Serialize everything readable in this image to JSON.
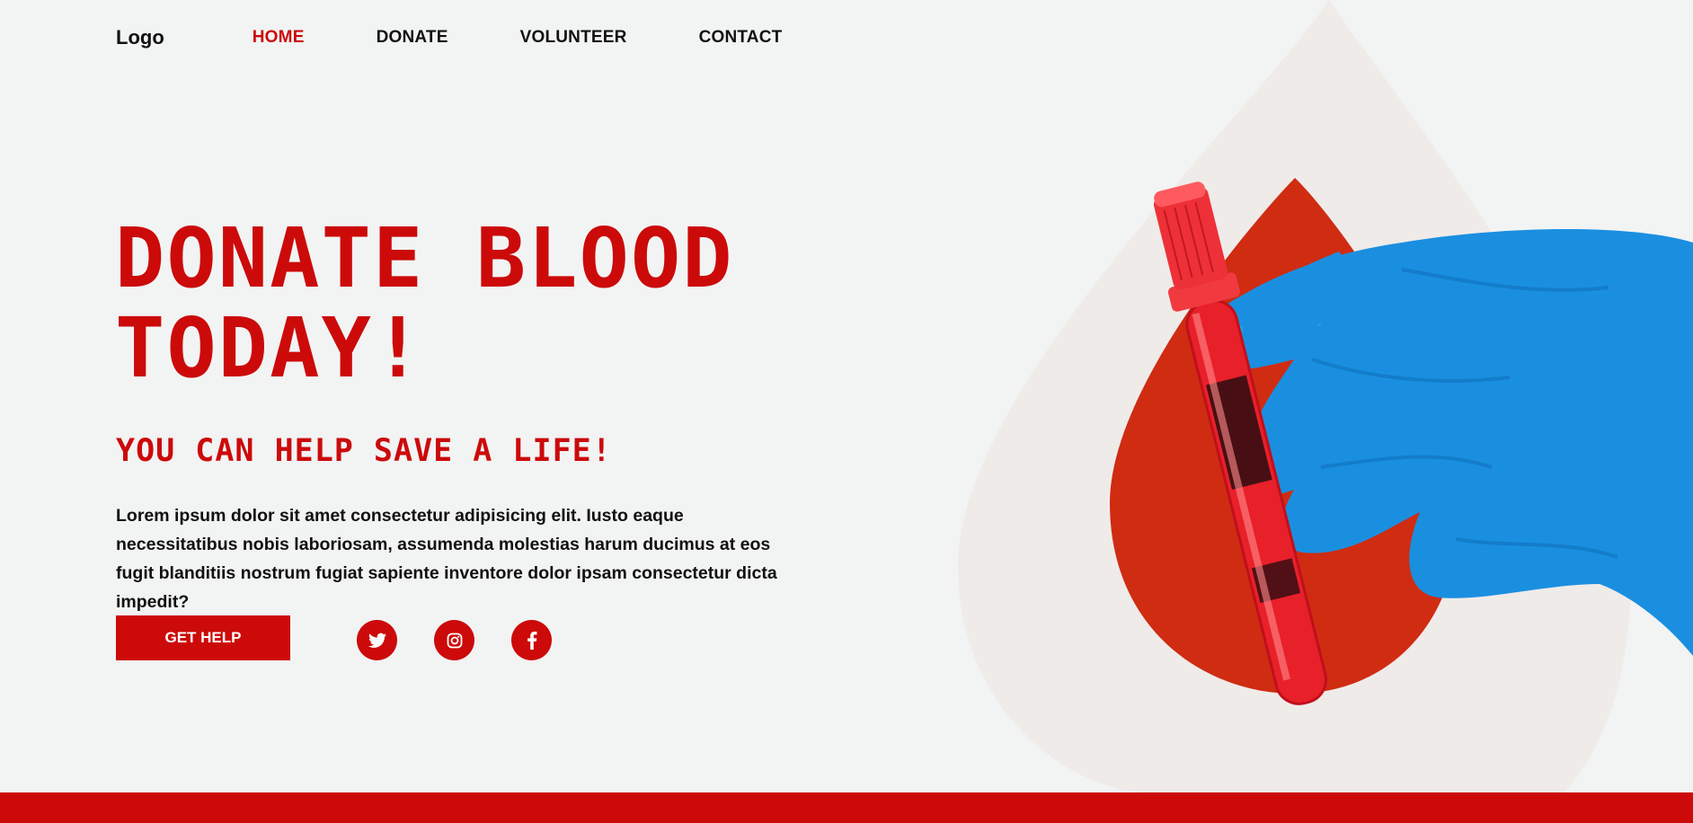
{
  "nav": {
    "logo": "Logo",
    "links": [
      "HOME",
      "DONATE",
      "VOLUNTEER",
      "CONTACT"
    ],
    "active": "HOME"
  },
  "hero": {
    "headline_line1": "DONATE BLOOD",
    "headline_line2": "TODAY!",
    "subhead": "YOU CAN HELP SAVE A LIFE!",
    "body": "Lorem ipsum dolor sit amet consectetur adipisicing elit. Iusto eaque necessitatibus nobis laboriosam, assumenda molestias harum ducimus at eos fugit blanditiis nostrum fugiat sapiente inventore dolor ipsam consectetur dicta impedit?",
    "cta_label": "GET HELP"
  },
  "social": [
    {
      "icon": "twitter-icon"
    },
    {
      "icon": "instagram-icon"
    },
    {
      "icon": "facebook-icon"
    }
  ],
  "colors": {
    "accent": "#cc0a0a",
    "background": "#f2f3f3",
    "drop_outer": "#efebe9",
    "drop_inner": "#cf2c12",
    "glove": "#1a8fe0"
  }
}
